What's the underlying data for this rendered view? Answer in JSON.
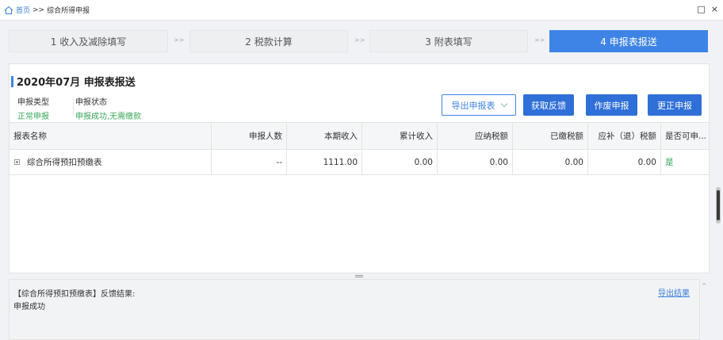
{
  "breadcrumb": {
    "home": "首页",
    "separator": ">>",
    "current": "综合所得申报"
  },
  "window": {
    "restore": "□",
    "close": "×"
  },
  "steps": [
    {
      "label": "1 收入及减除填写"
    },
    {
      "label": "2 税款计算"
    },
    {
      "label": "3 附表填写"
    },
    {
      "label": "4 申报表报送"
    }
  ],
  "step_arrow": ">>",
  "step_active_index": 3,
  "header": {
    "title": "2020年07月  申报表报送"
  },
  "info": {
    "type_label": "申报类型",
    "type_value": "正常申报",
    "status_label": "申报状态",
    "status_value": "申报成功,无需缴款"
  },
  "buttons": {
    "export_report": "导出申报表",
    "get_feedback": "获取反馈",
    "void_report": "作废申报",
    "correct_report": "更正申报"
  },
  "table": {
    "columns": [
      "报表名称",
      "申报人数",
      "本期收入",
      "累计收入",
      "应纳税额",
      "已缴税额",
      "应补（退）税额",
      "是否可申..."
    ],
    "rows": [
      [
        "综合所得预扣预缴表",
        "--",
        "1111.00",
        "0.00",
        "0.00",
        "0.00",
        "0.00",
        "是"
      ]
    ]
  },
  "result": {
    "title": "【综合所得预扣预缴表】反馈结果:",
    "text": "申报成功",
    "export_link": "导出结果"
  },
  "colors": {
    "accent": "#3d84e6",
    "primary_button": "#2e6fd8",
    "success": "#3aaa5c",
    "link": "#3b7fd9"
  }
}
